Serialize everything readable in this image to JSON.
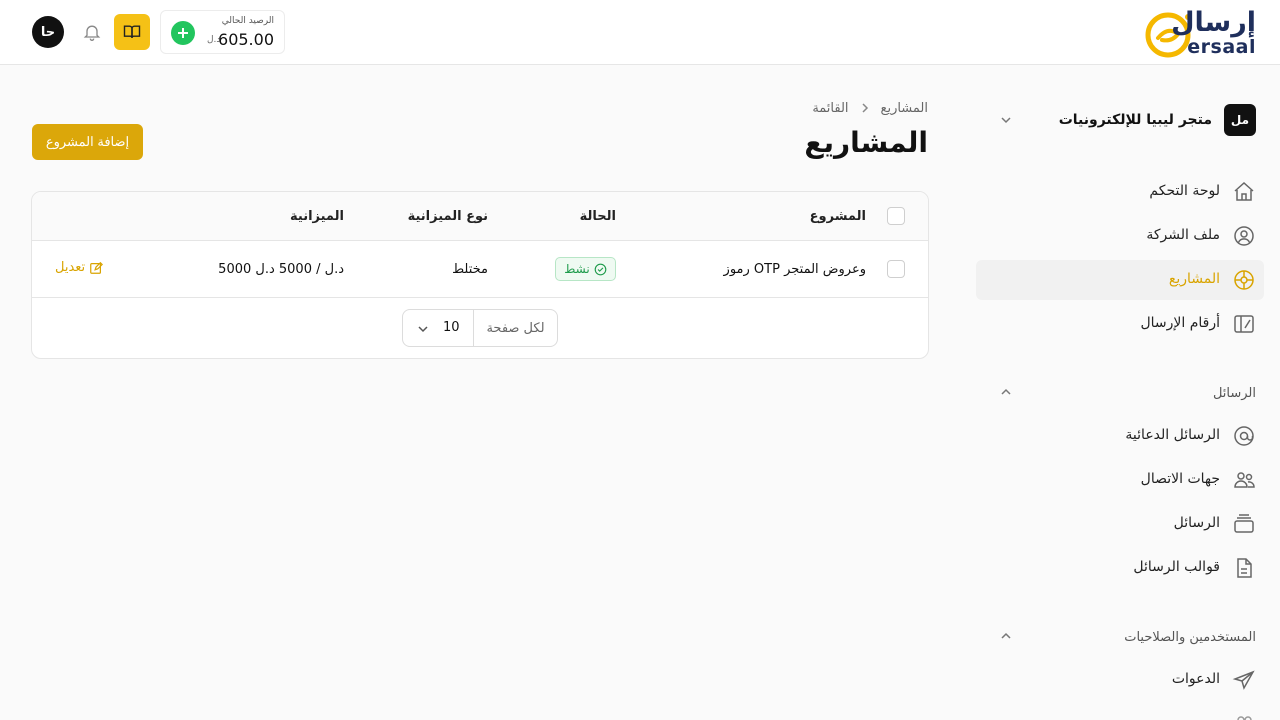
{
  "header": {
    "logo_ar": "إرسال",
    "logo_en": "ersaal",
    "user_initials": "حا",
    "balance_label": "الرصيد الحالي",
    "balance_value": "605.00",
    "balance_currency": "د.ل"
  },
  "sidebar": {
    "org_badge": "مل",
    "org_name": "متجر ليبيا للإلكترونيات",
    "main_items": [
      {
        "label": "لوحة التحكم",
        "icon": "home-icon"
      },
      {
        "label": "ملف الشركة",
        "icon": "user-circle-icon"
      },
      {
        "label": "المشاريع",
        "icon": "projects-icon",
        "active": true
      },
      {
        "label": "أرقام الإرسال",
        "icon": "sender-numbers-icon"
      }
    ],
    "sections": [
      {
        "title": "الرسائل",
        "items": [
          {
            "label": "الرسائل الدعائية",
            "icon": "at-icon"
          },
          {
            "label": "جهات الاتصال",
            "icon": "contacts-icon"
          },
          {
            "label": "الرسائل",
            "icon": "messages-stack-icon"
          },
          {
            "label": "قوالب الرسائل",
            "icon": "document-icon"
          }
        ]
      },
      {
        "title": "المستخدمين والصلاحيات",
        "items": [
          {
            "label": "الدعوات",
            "icon": "send-icon"
          }
        ]
      }
    ],
    "active_color": "#d9a400"
  },
  "main": {
    "breadcrumb": [
      "المشاريع",
      "القائمة"
    ],
    "title": "المشاريع",
    "add_button": "إضافة المشروع",
    "accent_color": "#dba70a",
    "table": {
      "columns": [
        "المشروع",
        "الحالة",
        "نوع الميزانية",
        "الميزانية"
      ],
      "rows": [
        {
          "project": "رموز OTP وعروض المتجر",
          "status": "نشط",
          "budget_type": "مختلط",
          "budget": "5000 د.ل / 5000 د.ل",
          "action": "تعديل"
        }
      ]
    },
    "pagination": {
      "per_page_label": "لكل صفحة",
      "per_page_value": "10"
    }
  }
}
